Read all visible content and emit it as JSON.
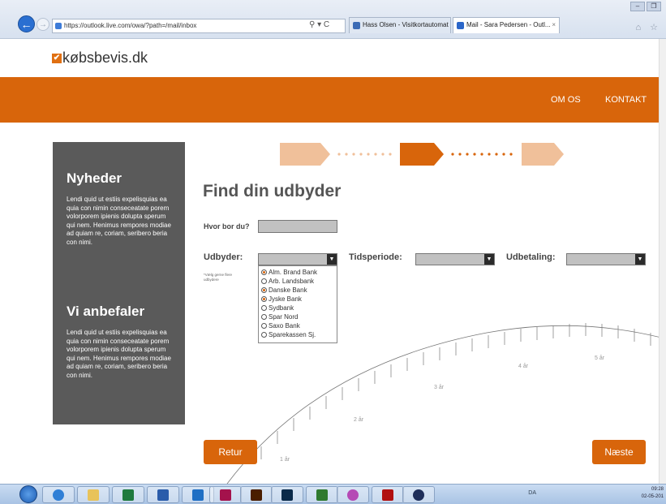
{
  "browser": {
    "url": "https://outlook.live.com/owa/?path=/mail/inbox",
    "tabs": [
      {
        "label": "Hass Olsen - Visitkortautomat"
      },
      {
        "label": "Mail - Sara Pedersen - Outl..."
      }
    ],
    "tab_close": "×",
    "addr_tools": "⚲ ▾ C",
    "win_min": "–",
    "win_max": "❐",
    "home_star": "⌂ ☆"
  },
  "site": {
    "logo_text": "købsbevis.dk",
    "logo_check": "✔",
    "nav": {
      "omos": "OM OS",
      "kontakt": "KONTAKT"
    },
    "accent": "#d8650b"
  },
  "sidebar": {
    "news_title": "Nyheder",
    "news_text": "Lendi quid ut estiis expelisquias ea quia con nimin conseceatate porem volorporem ipienis dolupta sperum qui nem. Henimus rempores modiae ad quiam re, coriam, seribero beria con nimi.",
    "rec_title": "Vi anbefaler",
    "rec_text": "Lendi quid ut estiis expelisquias ea quia con nimin conseceatate porem volorporem ipienis dolupta sperum qui nem. Henimus rempores modiae ad quiam re, coriam, seribero beria con nimi."
  },
  "stepper": {
    "current_step": 2,
    "total_steps": 3
  },
  "form": {
    "title": "Find din udbyder",
    "where_label": "Hvor bor du?",
    "provider_label": "Udbyder:",
    "provider_note": "*Vælg gerne flere udbydere",
    "period_label": "Tidsperiode:",
    "payment_label": "Udbetaling:",
    "banks": [
      {
        "name": "Alm. Brand Bank",
        "selected": true
      },
      {
        "name": "Arb. Landsbank",
        "selected": false
      },
      {
        "name": "Danske Bank",
        "selected": true
      },
      {
        "name": "Jyske Bank",
        "selected": true
      },
      {
        "name": "Sydbank",
        "selected": false
      },
      {
        "name": "Spar Nord",
        "selected": false
      },
      {
        "name": "Saxo Bank",
        "selected": false
      },
      {
        "name": "Sparekassen Sj.",
        "selected": false
      }
    ]
  },
  "timeline": {
    "years": [
      "1 år",
      "2 år",
      "3 år",
      "4 år",
      "5 år"
    ]
  },
  "buttons": {
    "back": "Retur",
    "next": "Næste"
  },
  "taskbar": {
    "apps": [
      "ie",
      "explorer",
      "excel",
      "word",
      "outlook",
      "indesign",
      "illustrator",
      "photoshop",
      "dreamweaver",
      "paint",
      "acrobat",
      "app"
    ],
    "lang": "DA",
    "time": "09:28",
    "date": "02-05-201"
  }
}
